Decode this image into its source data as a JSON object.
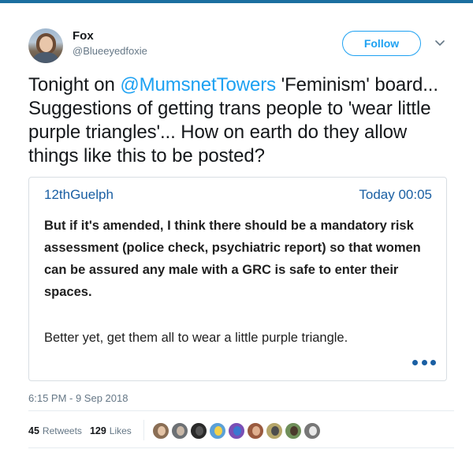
{
  "author": {
    "name": "Fox",
    "handle": "@Blueeyedfoxie"
  },
  "actions": {
    "follow_label": "Follow",
    "menu_icon": "chevron-down-icon"
  },
  "tweet": {
    "text_before": "Tonight on ",
    "mention": "@MumsnetTowers",
    "text_after": " 'Feminism' board... Suggestions of getting trans people to 'wear little purple triangles'... How on earth do they allow things like this to be posted?"
  },
  "quote": {
    "user": "12thGuelph",
    "time": "Today 00:05",
    "bold_text": "But if it's amended, I think there should be a mandatory risk assessment (police check, psychiatric report) so that women can be assured any male with a GRC is safe to enter their spaces.",
    "plain_text": "Better yet, get them all to wear a little purple triangle.",
    "more_icon": "more-dots-icon"
  },
  "meta": {
    "timestamp": "6:15 PM - 9 Sep 2018"
  },
  "stats": {
    "retweets_count": "45",
    "retweets_label": "Retweets",
    "likes_count": "129",
    "likes_label": "Likes"
  },
  "likers": [
    {
      "name": "liker-avatar-1",
      "bg": "#8a6e55",
      "face": "#e3c3a6"
    },
    {
      "name": "liker-avatar-2",
      "bg": "#6d7175",
      "face": "#c9b8a8"
    },
    {
      "name": "liker-avatar-3",
      "bg": "#2a2a2a",
      "face": "#555555"
    },
    {
      "name": "liker-avatar-4",
      "bg": "#5aa0d8",
      "face": "#f2d14b"
    },
    {
      "name": "liker-avatar-5",
      "bg": "#7a4fb5",
      "face": "#3a78d0"
    },
    {
      "name": "liker-avatar-6",
      "bg": "#9a5a3f",
      "face": "#e0b090"
    },
    {
      "name": "liker-avatar-7",
      "bg": "#b5a66a",
      "face": "#4d4d4d"
    },
    {
      "name": "liker-avatar-8",
      "bg": "#6f8f5a",
      "face": "#4b3a2c"
    },
    {
      "name": "liker-avatar-9",
      "bg": "#777777",
      "face": "#e9e9e9"
    }
  ]
}
